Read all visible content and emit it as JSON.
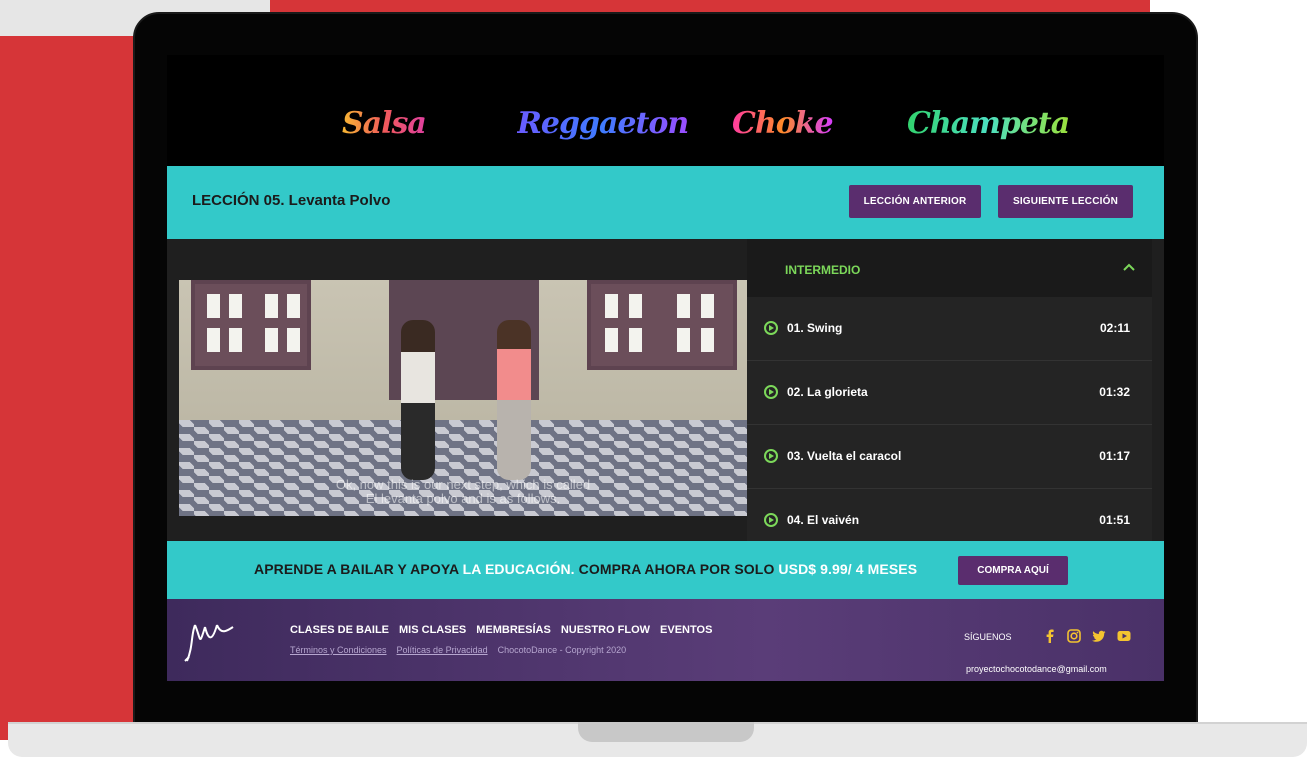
{
  "dance_styles": [
    "Salsa",
    "Reggaeton",
    "Choke",
    "Champeta"
  ],
  "lesson": {
    "title": "LECCIÓN 05. Levanta Polvo",
    "prev_label": "LECCIÓN ANTERIOR",
    "next_label": "SIGUIENTE LECCIÓN"
  },
  "video": {
    "subtitle_line1": "Ok, now this is our next step, which is called",
    "subtitle_line2": "El levanta polvo and is as follows."
  },
  "playlist": {
    "level": "INTERMEDIO",
    "items": [
      {
        "title": "01. Swing",
        "duration": "02:11"
      },
      {
        "title": "02. La glorieta",
        "duration": "01:32"
      },
      {
        "title": "03. Vuelta el caracol",
        "duration": "01:17"
      },
      {
        "title": "04. El vaivén",
        "duration": "01:51"
      }
    ]
  },
  "promo": {
    "part1": "APRENDE A BAILAR Y APOYA ",
    "part2": "LA EDUCACIÓN.",
    "part3": " COMPRA AHORA POR SOLO ",
    "part4": "USD$ 9.99/ 4 MESES",
    "button": "COMPRA AQUÍ"
  },
  "footer": {
    "nav": [
      "CLASES DE BAILE",
      "MIS CLASES",
      "MEMBRESÍAS",
      "NUESTRO FLOW",
      "EVENTOS"
    ],
    "terms": "Términos y Condiciones",
    "privacy": "Políticas de Privacidad",
    "copyright": "ChocotoDance - Copyright 2020",
    "follow": "SÍGUENOS",
    "email": "proyectochocotodance@gmail.com"
  },
  "colors": {
    "teal": "#33c9c9",
    "purple": "#5a2d6e",
    "green": "#7cd85a",
    "red": "#d63538"
  }
}
